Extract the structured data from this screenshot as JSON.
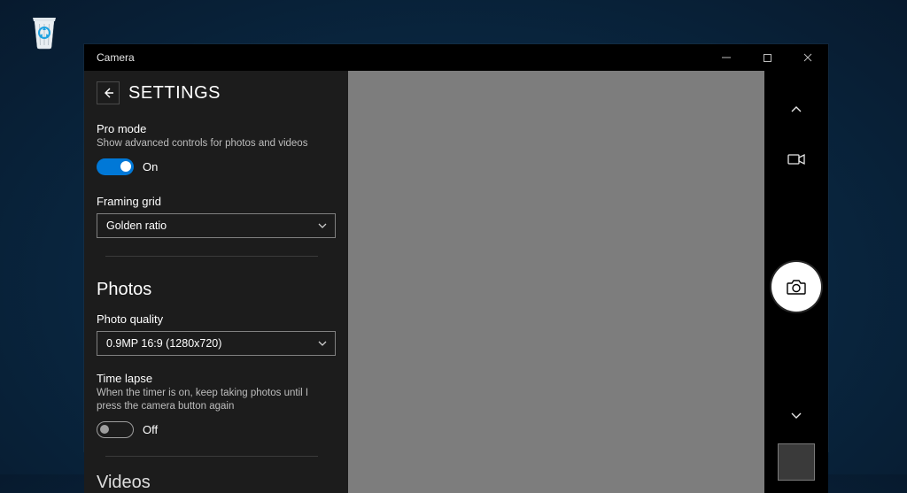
{
  "desktop": {
    "recycle_bin_label": "Recycle Bin"
  },
  "window": {
    "title": "Camera"
  },
  "settings": {
    "header": "SETTINGS",
    "pro_mode": {
      "label": "Pro mode",
      "desc": "Show advanced controls for photos and videos",
      "state": "On"
    },
    "framing": {
      "label": "Framing grid",
      "value": "Golden ratio"
    },
    "photos_section": "Photos",
    "photo_quality": {
      "label": "Photo quality",
      "value": "0.9MP 16:9 (1280x720)"
    },
    "time_lapse": {
      "label": "Time lapse",
      "desc": "When the timer is on, keep taking photos until I press the camera button again",
      "state": "Off"
    },
    "videos_section": "Videos"
  }
}
